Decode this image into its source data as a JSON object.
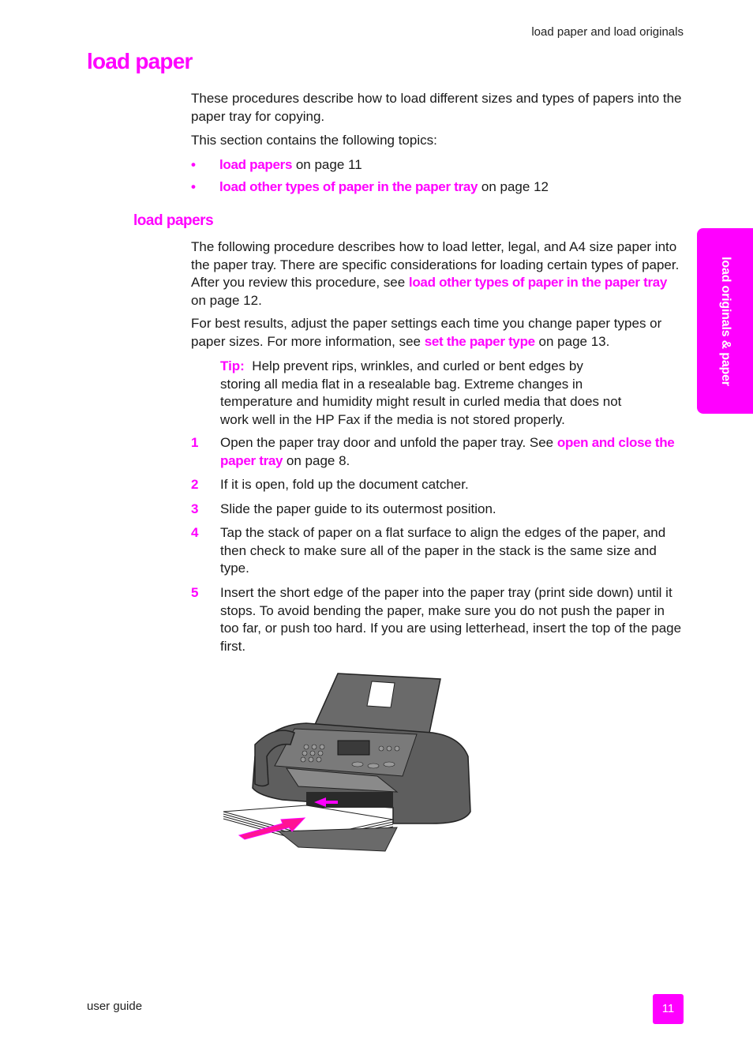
{
  "header": {
    "running_head": "load paper and load originals"
  },
  "page_title": "load paper",
  "intro": {
    "paragraph1": "These procedures describe how to load different sizes and types of papers into the paper tray for copying.",
    "paragraph2": "This section contains the following topics:",
    "topics": [
      {
        "bullet": "•",
        "link": "load papers",
        "suffix": " on page 11"
      },
      {
        "bullet": "•",
        "link": "load other types of paper in the paper tray",
        "suffix": " on page 12"
      }
    ]
  },
  "section": {
    "heading": "load papers",
    "paragraph1": {
      "before": "The following procedure describes how to load letter, legal, and A4 size paper into the paper tray. There are specific considerations for loading certain types of paper. After you review this procedure, see ",
      "link": "load other types of paper in the paper tray",
      "after": " on page 12."
    },
    "paragraph2": {
      "before": "For best results, adjust the paper settings each time you change paper types or paper sizes. For more information, see ",
      "link": "set the paper type",
      "after": " on page 13."
    },
    "tip": {
      "label": "Tip:",
      "text": "  Help prevent rips, wrinkles, and curled or bent edges by storing all media flat in a resealable bag. Extreme changes in temperature and humidity might result in curled media that does not work well in the HP Fax if the media is not stored properly."
    },
    "steps": [
      {
        "num": "1",
        "before": "Open the paper tray door and unfold the paper tray. See ",
        "link": "open and close the paper tray",
        "after": " on page 8."
      },
      {
        "num": "2",
        "text": "If it is open, fold up the document catcher."
      },
      {
        "num": "3",
        "text": "Slide the paper guide to its outermost position."
      },
      {
        "num": "4",
        "text": "Tap the stack of paper on a flat surface to align the edges of the paper, and then check to make sure all of the paper in the stack is the same size and type."
      },
      {
        "num": "5",
        "text": "Insert the short edge of the paper into the paper tray (print side down) until it stops. To avoid bending the paper, make sure you do not push the paper in too far, or push too hard. If you are using letterhead, insert the top of the page first."
      }
    ],
    "figure": {
      "description": "HP Fax with paper being inserted into the paper tray"
    }
  },
  "side_tab": {
    "label": "load originals & paper"
  },
  "footer": {
    "left": "user guide",
    "page_number": "11"
  },
  "colors": {
    "accent": "#ff00ff",
    "text": "#1a1a1a",
    "device": "#5a5a5a"
  }
}
